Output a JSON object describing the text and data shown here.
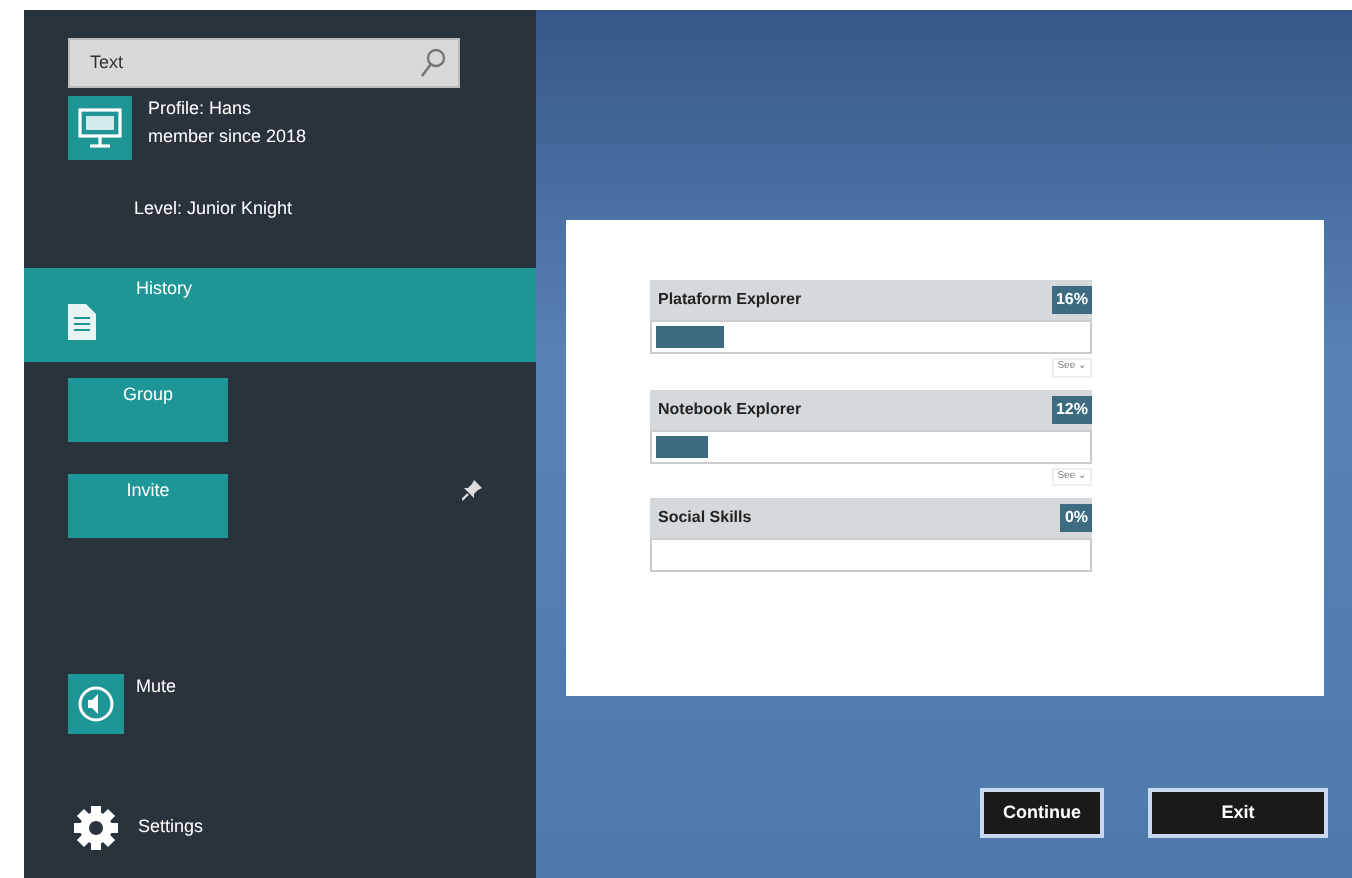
{
  "search": {
    "value": "Text"
  },
  "profile": {
    "name": "Profile: Hans",
    "since": "member since 2018",
    "level": "Level: Junior Knight"
  },
  "menu": [
    {
      "label": "History",
      "selected": true,
      "kind": "row"
    },
    {
      "label": "Group",
      "selected": false,
      "kind": "tile"
    },
    {
      "label": "Invite",
      "selected": false,
      "kind": "tile"
    }
  ],
  "mute": {
    "label": "Mute"
  },
  "settings": {
    "label": "Settings"
  },
  "skills": [
    {
      "name": "Plataform Explorer",
      "percent": "16%",
      "level": 0.16,
      "more": "See ⌄"
    },
    {
      "name": "Notebook Explorer",
      "percent": "12%",
      "level": 0.12,
      "more": "See ⌄"
    },
    {
      "name": "Social Skills",
      "percent": "0%",
      "level": 0
    }
  ],
  "buttons": [
    "Continue",
    "Exit"
  ]
}
